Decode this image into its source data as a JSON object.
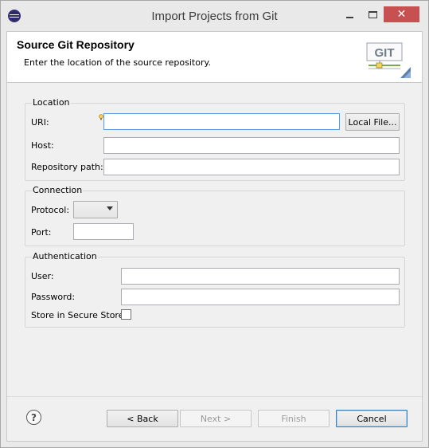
{
  "window": {
    "title": "Import Projects from Git",
    "controls": {
      "minimize": "minimize",
      "maximize": "maximize",
      "close": "✕"
    }
  },
  "header": {
    "title": "Source Git Repository",
    "description": "Enter the location of the source repository.",
    "logo_text": "GIT"
  },
  "location": {
    "group_label": "Location",
    "uri_label": "URI:",
    "uri_value": "",
    "local_file_button": "Local File...",
    "host_label": "Host:",
    "host_value": "",
    "repo_path_label": "Repository path:",
    "repo_path_value": ""
  },
  "connection": {
    "group_label": "Connection",
    "protocol_label": "Protocol:",
    "protocol_value": "",
    "port_label": "Port:",
    "port_value": ""
  },
  "authentication": {
    "group_label": "Authentication",
    "user_label": "User:",
    "user_value": "",
    "password_label": "Password:",
    "password_value": "",
    "secure_store_label": "Store in Secure Store",
    "secure_store_checked": false
  },
  "footer": {
    "help_symbol": "?",
    "back_button": "< Back",
    "next_button": "Next >",
    "finish_button": "Finish",
    "cancel_button": "Cancel"
  },
  "colors": {
    "close_button": "#c75050",
    "focus_border": "#569de5",
    "window_bg": "#e9e9e9",
    "dialog_bg": "#f0f0f0"
  }
}
